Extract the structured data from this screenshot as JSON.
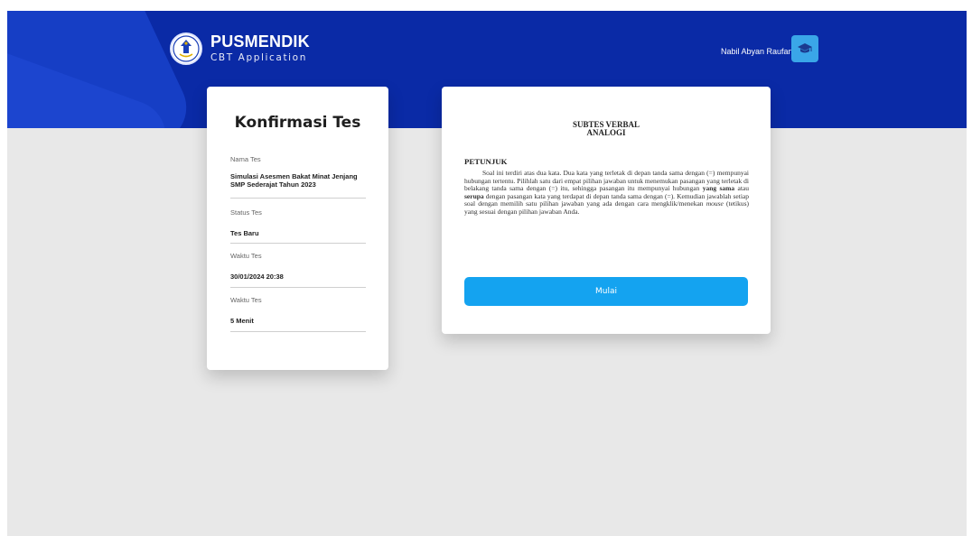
{
  "header": {
    "brand_title": "PUSMENDIK",
    "brand_subtitle": "CBT Application",
    "user_name": "Nabil Abyan Raufan",
    "colors": {
      "header_bg": "#0a2aa6",
      "avatar_bg": "#3aa6e8"
    },
    "icons": {
      "logo": "tut-wuri-handayani-logo",
      "avatar": "graduation-cap-icon"
    }
  },
  "confirm": {
    "title": "Konfirmasi Tes",
    "fields": [
      {
        "label": "Nama Tes",
        "value": "Simulasi Asesmen Bakat Minat Jenjang SMP Sederajat Tahun 2023"
      },
      {
        "label": "Status Tes",
        "value": "Tes Baru"
      },
      {
        "label": "Waktu Tes",
        "value": "30/01/2024 20:38"
      },
      {
        "label": "Waktu Tes",
        "value": "5 Menit"
      }
    ]
  },
  "instructions": {
    "subtes_line1": "SUBTES VERBAL",
    "subtes_line2": "ANALOGI",
    "heading": "PETUNJUK",
    "text_part1": "Soal ini terdiri atas dua kata. Dua kata yang terletak di depan tanda sama dengan (=) mempunyai hubungan tertentu. Pilihlah satu dari empat pilihan jawaban untuk menemukan pasangan yang terletak di belakang tanda sama dengan (=) itu, sehingga pasangan itu mempunyai hubungan ",
    "text_bold1": "yang sama",
    "text_part2": " atau ",
    "text_bold2": "serupa",
    "text_part3": " dengan pasangan kata yang terdapat di depan tanda sama dengan (=). Kemudian jawablah setiap soal dengan memilih satu pilihan jawaban yang ada dengan cara mengklik/menekan ",
    "text_italic": "mouse",
    "text_part4": " (tetikus) yang sesuai dengan pilihan jawaban Anda.",
    "start_button": "Mulai",
    "colors": {
      "button_bg": "#14a3f0"
    }
  }
}
